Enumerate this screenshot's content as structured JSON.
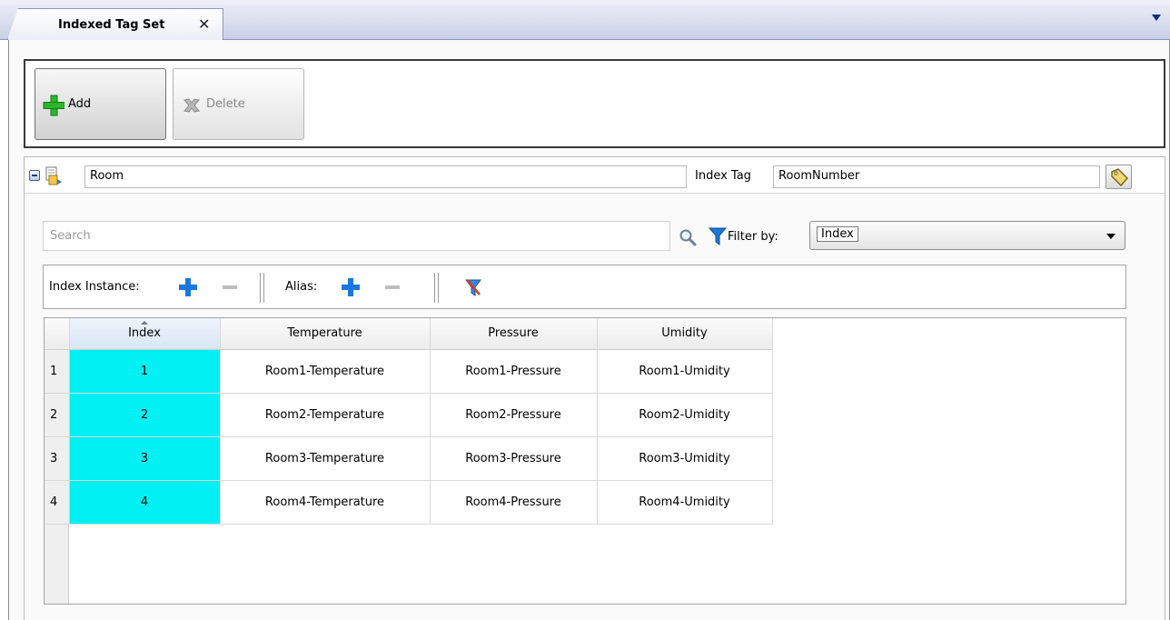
{
  "tab": {
    "title": "Indexed Tag Set"
  },
  "toolbar": {
    "add_label": "Add",
    "delete_label": "Delete"
  },
  "group": {
    "name": "Room",
    "index_tag_label": "Index Tag",
    "index_tag_value": "RoomNumber"
  },
  "search": {
    "placeholder": "Search",
    "filter_label": "Filter by:",
    "filter_value": "Index"
  },
  "instance_bar": {
    "index_instance_label": "Index Instance:",
    "alias_label": "Alias:"
  },
  "grid": {
    "columns": [
      "Index",
      "Temperature",
      "Pressure",
      "Umidity"
    ],
    "rows": [
      {
        "row": "1",
        "index": "1",
        "temperature": "Room1-Temperature",
        "pressure": "Room1-Pressure",
        "umidity": "Room1-Umidity"
      },
      {
        "row": "2",
        "index": "2",
        "temperature": "Room2-Temperature",
        "pressure": "Room2-Pressure",
        "umidity": "Room2-Umidity"
      },
      {
        "row": "3",
        "index": "3",
        "temperature": "Room3-Temperature",
        "pressure": "Room3-Pressure",
        "umidity": "Room3-Umidity"
      },
      {
        "row": "4",
        "index": "4",
        "temperature": "Room4-Temperature",
        "pressure": "Room4-Pressure",
        "umidity": "Room4-Umidity"
      }
    ]
  },
  "colors": {
    "index_cell": "#00f0f4",
    "tab_accent": "#0b2a88",
    "add_plus": "#2bb52b",
    "blue_plus": "#1878e0"
  }
}
